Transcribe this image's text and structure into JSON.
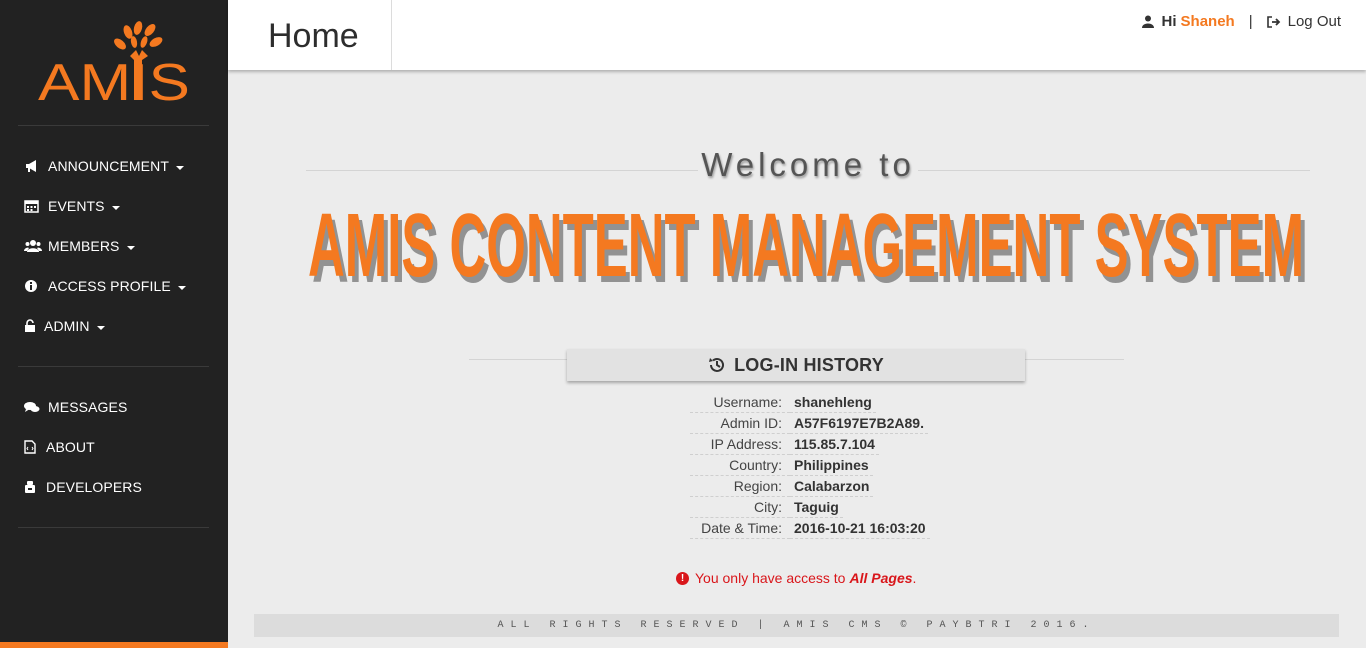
{
  "brand": {
    "logo_text": "AMIS",
    "accent": "#f47920",
    "sidebar_bg": "#222222"
  },
  "sidebar": {
    "menu": [
      {
        "label": "ANNOUNCEMENT",
        "icon": "bullhorn-icon",
        "dropdown": true
      },
      {
        "label": "EVENTS",
        "icon": "calendar-icon",
        "dropdown": true
      },
      {
        "label": "MEMBERS",
        "icon": "users-icon",
        "dropdown": true
      },
      {
        "label": "ACCESS PROFILE",
        "icon": "info-circle-icon",
        "dropdown": true
      },
      {
        "label": "ADMIN",
        "icon": "unlock-icon",
        "dropdown": true
      }
    ],
    "secondary": [
      {
        "label": "MESSAGES",
        "icon": "comments-icon"
      },
      {
        "label": "ABOUT",
        "icon": "file-code-icon"
      },
      {
        "label": "DEVELOPERS",
        "icon": "developers-icon"
      }
    ]
  },
  "header": {
    "title": "Home",
    "greeting": "Hi",
    "username": "Shaneh",
    "separator": "|",
    "logout_label": "Log Out"
  },
  "welcome": {
    "pre": "Welcome to",
    "title": "AMIS CONTENT MANAGEMENT SYSTEM"
  },
  "login_history": {
    "heading": "LOG-IN HISTORY",
    "rows": [
      {
        "label": "Username:",
        "value": "shanehleng"
      },
      {
        "label": "Admin ID:",
        "value": "A57F6197E7B2A89."
      },
      {
        "label": "IP Address:",
        "value": "115.85.7.104"
      },
      {
        "label": "Country:",
        "value": "Philippines"
      },
      {
        "label": "Region:",
        "value": "Calabarzon"
      },
      {
        "label": "City:",
        "value": "Taguig"
      },
      {
        "label": "Date & Time:",
        "value": "2016-10-21 16:03:20"
      }
    ]
  },
  "notice": {
    "text": "You only have access to",
    "emphasis": "All Pages",
    "end": "."
  },
  "footer": {
    "text": "ALL RIGHTS RESERVED | AMIS CMS © PAYBTRI 2016."
  }
}
